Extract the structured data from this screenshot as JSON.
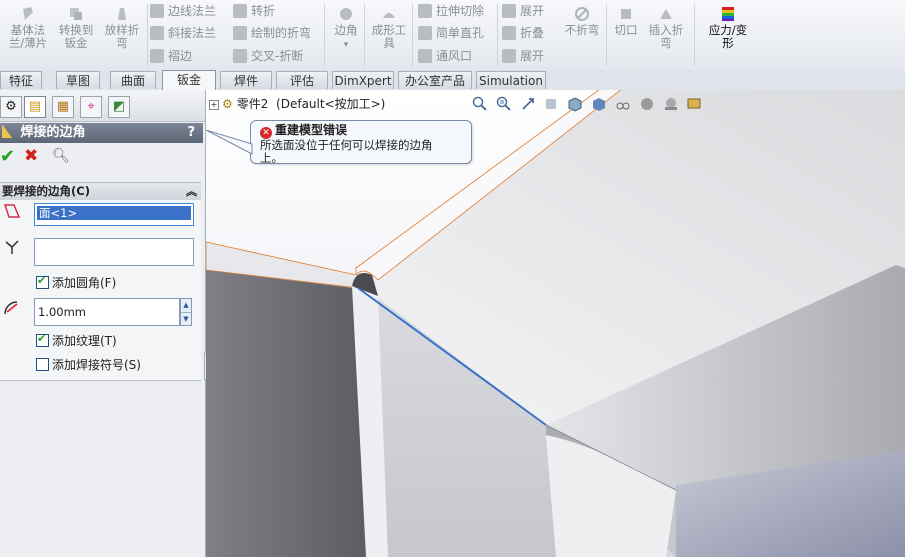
{
  "ribbon": {
    "large_buttons": [
      {
        "label_l1": "基体法",
        "label_l2": "兰/薄片",
        "icon": "base-flange-icon"
      },
      {
        "label_l1": "转换到",
        "label_l2": "钣金",
        "icon": "convert-to-sheet-metal-icon"
      },
      {
        "label_l1": "放样折",
        "label_l2": "弯",
        "icon": "lofted-bend-icon"
      },
      {
        "label_l1": "边角",
        "label_l2": "",
        "icon": "corners-icon"
      },
      {
        "label_l1": "成形工",
        "label_l2": "具",
        "icon": "forming-tool-icon"
      },
      {
        "label_l1": "不折弯",
        "label_l2": "",
        "icon": "no-bends-icon"
      },
      {
        "label_l1": "切口",
        "label_l2": "",
        "icon": "rip-icon"
      },
      {
        "label_l1": "插入折",
        "label_l2": "弯",
        "icon": "insert-bends-icon"
      },
      {
        "label_l1": "应力/变",
        "label_l2": "形",
        "icon": "stress-deformation-icon"
      }
    ],
    "small_buttons": {
      "col1": [
        "边线法兰",
        "斜接法兰",
        "褶边"
      ],
      "col2": [
        "转折",
        "绘制的折弯",
        "交叉-折断"
      ],
      "col3": [
        "拉伸切除",
        "简单直孔",
        "通风口"
      ],
      "col4": [
        "展开",
        "折叠",
        "展开"
      ]
    },
    "tabs": [
      "特征",
      "草图",
      "曲面",
      "钣金",
      "焊件",
      "评估",
      "DimXpert",
      "办公室产品",
      "Simulation"
    ],
    "active_tab": "钣金"
  },
  "property_manager": {
    "title": "焊接的边角",
    "help": "?",
    "group_title": "要焊接的边角(C)",
    "selected_face": "面<1>",
    "stop_at_field": "",
    "add_fillet_label": "添加圆角(F)",
    "add_fillet_checked": true,
    "radius_value": "1.00mm",
    "add_texture_label": "添加纹理(T)",
    "add_texture_checked": true,
    "add_weld_symbol_label": "添加焊接符号(S)",
    "add_weld_symbol_checked": false,
    "collapse_glyph": "《"
  },
  "viewport": {
    "tree_label": "零件2",
    "config_label": "(Default<按加工>)",
    "error_title": "重建模型错误",
    "error_message_l1": "所选面没位于任何可以焊接的边角",
    "error_message_l2": "上。"
  },
  "colors": {
    "accent_blue": "#3a72c8",
    "error_red": "#d42a2a",
    "header_gray": "#5d6778",
    "orange_edge": "#e07a26"
  }
}
